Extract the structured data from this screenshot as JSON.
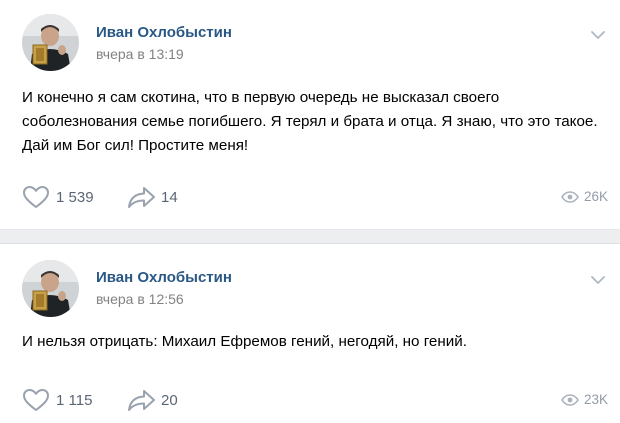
{
  "posts": [
    {
      "author": "Иван Охлобыстин",
      "time": "вчера в 13:19",
      "text": "И конечно я сам скотина, что в первую очередь не высказал своего соболезнования семье погибшего. Я терял и брата и отца. Я знаю, что это такое. Дай им Бог сил! Простите меня!",
      "likes": "1 539",
      "shares": "14",
      "views": "26K"
    },
    {
      "author": "Иван Охлобыстин",
      "time": "вчера в 12:56",
      "text": "И нельзя отрицать: Михаил Ефремов гений, негодяй, но гений.",
      "likes": "1 115",
      "shares": "20",
      "views": "23K"
    }
  ],
  "icons": {
    "like": "heart-icon",
    "share": "share-arrow-icon",
    "views": "eye-icon",
    "menu": "chevron-down-icon"
  },
  "colors": {
    "author_link": "#2a5885",
    "meta": "#828282",
    "action": "#5b6675",
    "action_icon": "#99a2ad",
    "feed_bg": "#edeef0"
  }
}
